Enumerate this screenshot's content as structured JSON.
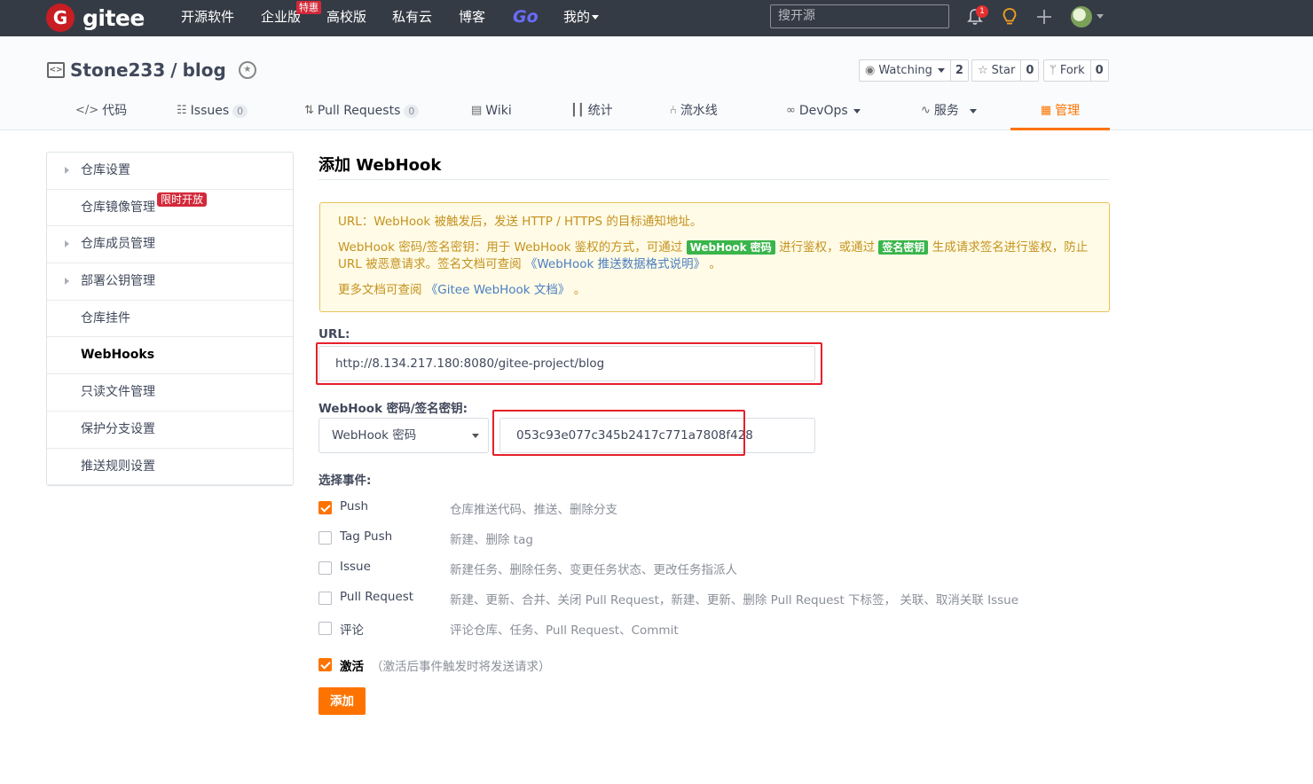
{
  "brand": {
    "name": "gitee",
    "logo_letter": "G"
  },
  "topnav": {
    "items": [
      "开源软件",
      "企业版",
      "高校版",
      "私有云",
      "博客",
      "Go",
      "我的"
    ],
    "enterprise_badge": "特惠",
    "search_placeholder": "搜开源",
    "notification_count": "1"
  },
  "repo": {
    "owner": "Stone233",
    "separator": "/",
    "name": "blog",
    "watch_label": "Watching",
    "watch_count": "2",
    "star_label": "Star",
    "star_count": "0",
    "fork_label": "Fork",
    "fork_count": "0"
  },
  "tabs": [
    {
      "label": "代码"
    },
    {
      "label": "Issues",
      "count": "0"
    },
    {
      "label": "Pull Requests",
      "count": "0"
    },
    {
      "label": "Wiki"
    },
    {
      "label": "统计"
    },
    {
      "label": "流水线"
    },
    {
      "label": "DevOps"
    },
    {
      "label": "服务"
    },
    {
      "label": "管理"
    }
  ],
  "sidebar": {
    "items": [
      {
        "label": "仓库设置"
      },
      {
        "label": "仓库镜像管理",
        "badge": "限时开放"
      },
      {
        "label": "仓库成员管理"
      },
      {
        "label": "部署公钥管理"
      },
      {
        "label": "仓库挂件"
      },
      {
        "label": "WebHooks"
      },
      {
        "label": "只读文件管理"
      },
      {
        "label": "保护分支设置"
      },
      {
        "label": "推送规则设置"
      }
    ]
  },
  "main": {
    "title": "添加 WebHook",
    "notice": {
      "line1": "URL：WebHook 被触发后，发送 HTTP / HTTPS 的目标通知地址。",
      "line2_a": "WebHook 密码/签名密钥：用于 WebHook 鉴权的方式，可通过",
      "tag1": "WebHook 密码",
      "line2_b": "进行鉴权，或通过",
      "tag2": "签名密钥",
      "line2_c": "生成请求签名进行鉴权，防止 URL 被恶意请求。签名文档可查阅",
      "link1": "《WebHook 推送数据格式说明》",
      "line2_d": "。",
      "line3_a": "更多文档可查阅",
      "link2": "《Gitee WebHook 文档》",
      "line3_b": "。"
    },
    "url_label": "URL:",
    "url_value": "http://8.134.217.180:8080/gitee-project/blog",
    "secret_label": "WebHook 密码/签名密钥:",
    "secret_type": "WebHook 密码",
    "secret_value": "053c93e077c345b2417c771a7808f428",
    "events_label": "选择事件:",
    "events": [
      {
        "name": "Push",
        "desc": "仓库推送代码、推送、删除分支",
        "checked": true
      },
      {
        "name": "Tag Push",
        "desc": "新建、删除 tag",
        "checked": false
      },
      {
        "name": "Issue",
        "desc": "新建任务、删除任务、变更任务状态、更改任务指派人",
        "checked": false
      },
      {
        "name": "Pull Request",
        "desc": "新建、更新、合并、关闭 Pull Request，新建、更新、删除 Pull Request 下标签， 关联、取消关联 Issue",
        "checked": false
      },
      {
        "name": "评论",
        "desc": "评论仓库、任务、Pull Request、Commit",
        "checked": false
      }
    ],
    "active_label": "激活",
    "active_desc": "（激活后事件触发时将发送请求）",
    "active_checked": true,
    "submit_label": "添加"
  },
  "colors": {
    "accent": "#fe7300",
    "navbar": "#353b45",
    "highlight": "#e5202a"
  }
}
